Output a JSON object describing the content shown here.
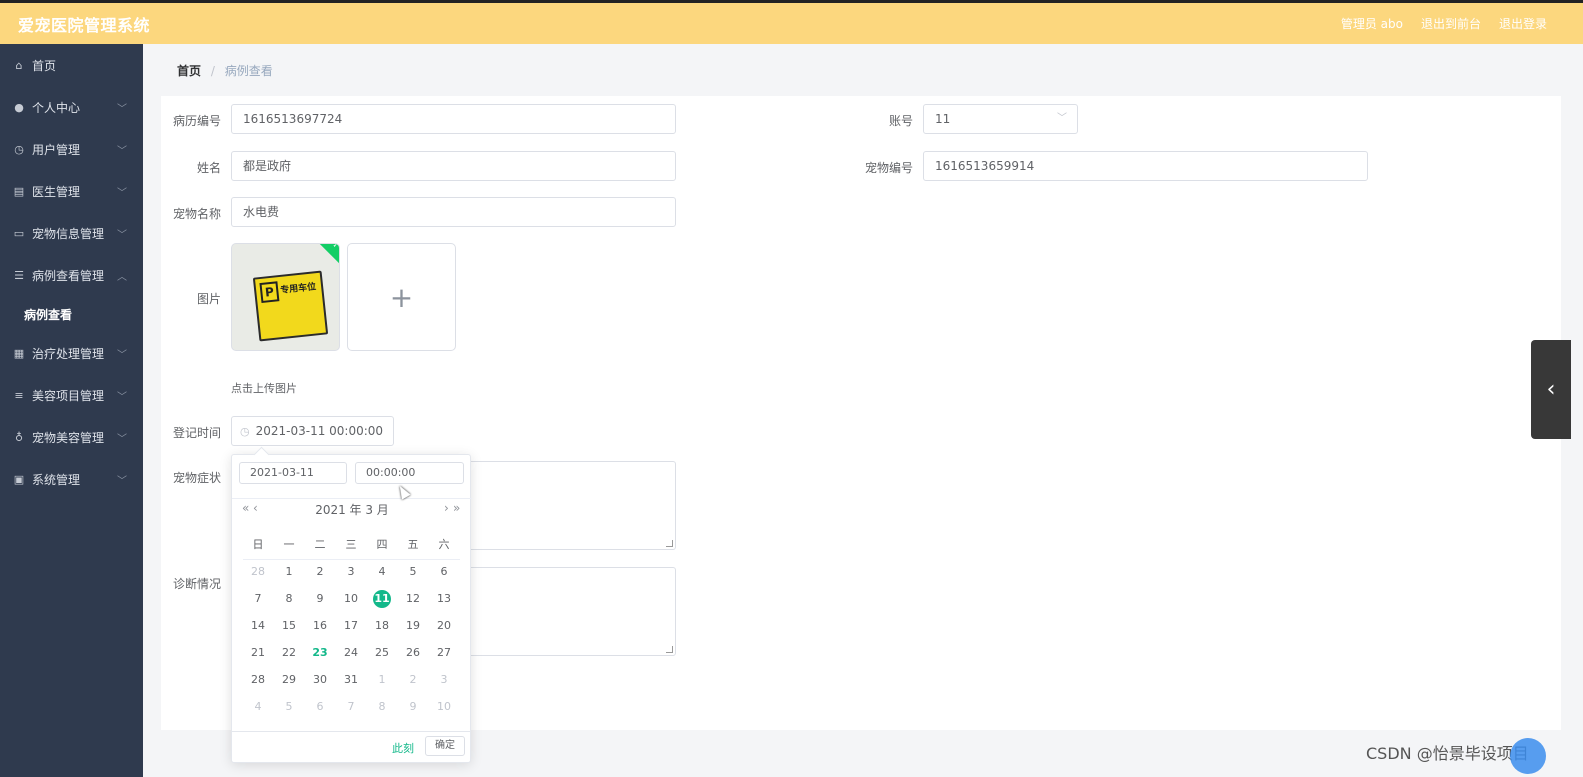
{
  "header": {
    "title": "爱宠医院管理系统",
    "admin_label": "管理员 abo",
    "exit_frontend": "退出到前台",
    "logout": "退出登录"
  },
  "sidebar": {
    "items": [
      {
        "label": "首页",
        "icon": "home-icon"
      },
      {
        "label": "个人中心",
        "icon": "user-icon"
      },
      {
        "label": "用户管理",
        "icon": "clock-icon"
      },
      {
        "label": "医生管理",
        "icon": "doctor-icon"
      },
      {
        "label": "宠物信息管理",
        "icon": "chat-icon"
      },
      {
        "label": "病例查看管理",
        "icon": "sliders-icon"
      },
      {
        "label": "病例查看",
        "icon": ""
      },
      {
        "label": "治疗处理管理",
        "icon": "chart-icon"
      },
      {
        "label": "美容项目管理",
        "icon": "list-icon"
      },
      {
        "label": "宠物美容管理",
        "icon": "mic-icon"
      },
      {
        "label": "系统管理",
        "icon": "clipboard-icon"
      }
    ]
  },
  "breadcrumb": {
    "home": "首页",
    "separator": "/",
    "current": "病例查看"
  },
  "form": {
    "record_no": {
      "label": "病历编号",
      "value": "1616513697724"
    },
    "account": {
      "label": "账号",
      "value": "11"
    },
    "name": {
      "label": "姓名",
      "value": "都是政府"
    },
    "pet_no": {
      "label": "宠物编号",
      "value": "1616513659914"
    },
    "pet_name": {
      "label": "宠物名称",
      "value": "水电费"
    },
    "image": {
      "label": "图片",
      "upload_hint": "点击上传图片",
      "sign_text": "专用车位",
      "sign_logo": "P"
    },
    "register_time": {
      "label": "登记时间",
      "value": "2021-03-11 00:00:00"
    },
    "symptom": {
      "label": "宠物症状"
    },
    "diagnosis": {
      "label": "诊断情况"
    }
  },
  "picker": {
    "date_value": "2021-03-11",
    "time_value": "00:00:00",
    "title": "2021 年  3 月",
    "prev_year": "«",
    "prev_month": "‹",
    "next_month": "›",
    "next_year": "»",
    "weekdays": [
      "日",
      "一",
      "二",
      "三",
      "四",
      "五",
      "六"
    ],
    "weeks": [
      [
        {
          "d": "28",
          "t": "other"
        },
        {
          "d": "1"
        },
        {
          "d": "2"
        },
        {
          "d": "3"
        },
        {
          "d": "4"
        },
        {
          "d": "5"
        },
        {
          "d": "6"
        }
      ],
      [
        {
          "d": "7"
        },
        {
          "d": "8"
        },
        {
          "d": "9"
        },
        {
          "d": "10"
        },
        {
          "d": "11",
          "t": "selected"
        },
        {
          "d": "12"
        },
        {
          "d": "13"
        }
      ],
      [
        {
          "d": "14"
        },
        {
          "d": "15"
        },
        {
          "d": "16"
        },
        {
          "d": "17"
        },
        {
          "d": "18"
        },
        {
          "d": "19"
        },
        {
          "d": "20"
        }
      ],
      [
        {
          "d": "21"
        },
        {
          "d": "22"
        },
        {
          "d": "23",
          "t": "today"
        },
        {
          "d": "24"
        },
        {
          "d": "25"
        },
        {
          "d": "26"
        },
        {
          "d": "27"
        }
      ],
      [
        {
          "d": "28"
        },
        {
          "d": "29"
        },
        {
          "d": "30"
        },
        {
          "d": "31"
        },
        {
          "d": "1",
          "t": "other"
        },
        {
          "d": "2",
          "t": "other"
        },
        {
          "d": "3",
          "t": "other"
        }
      ],
      [
        {
          "d": "4",
          "t": "other"
        },
        {
          "d": "5",
          "t": "other"
        },
        {
          "d": "6",
          "t": "other"
        },
        {
          "d": "7",
          "t": "other"
        },
        {
          "d": "8",
          "t": "other"
        },
        {
          "d": "9",
          "t": "other"
        },
        {
          "d": "10",
          "t": "other"
        }
      ]
    ],
    "now_label": "此刻",
    "confirm_label": "确定"
  },
  "drawer_tab": {
    "icon": "chevron-left-icon"
  },
  "watermark": "CSDN @怡景毕设项目",
  "colors": {
    "header": "#fcd77e",
    "sidebar": "#2f3a4e",
    "accent": "#13b88a"
  }
}
